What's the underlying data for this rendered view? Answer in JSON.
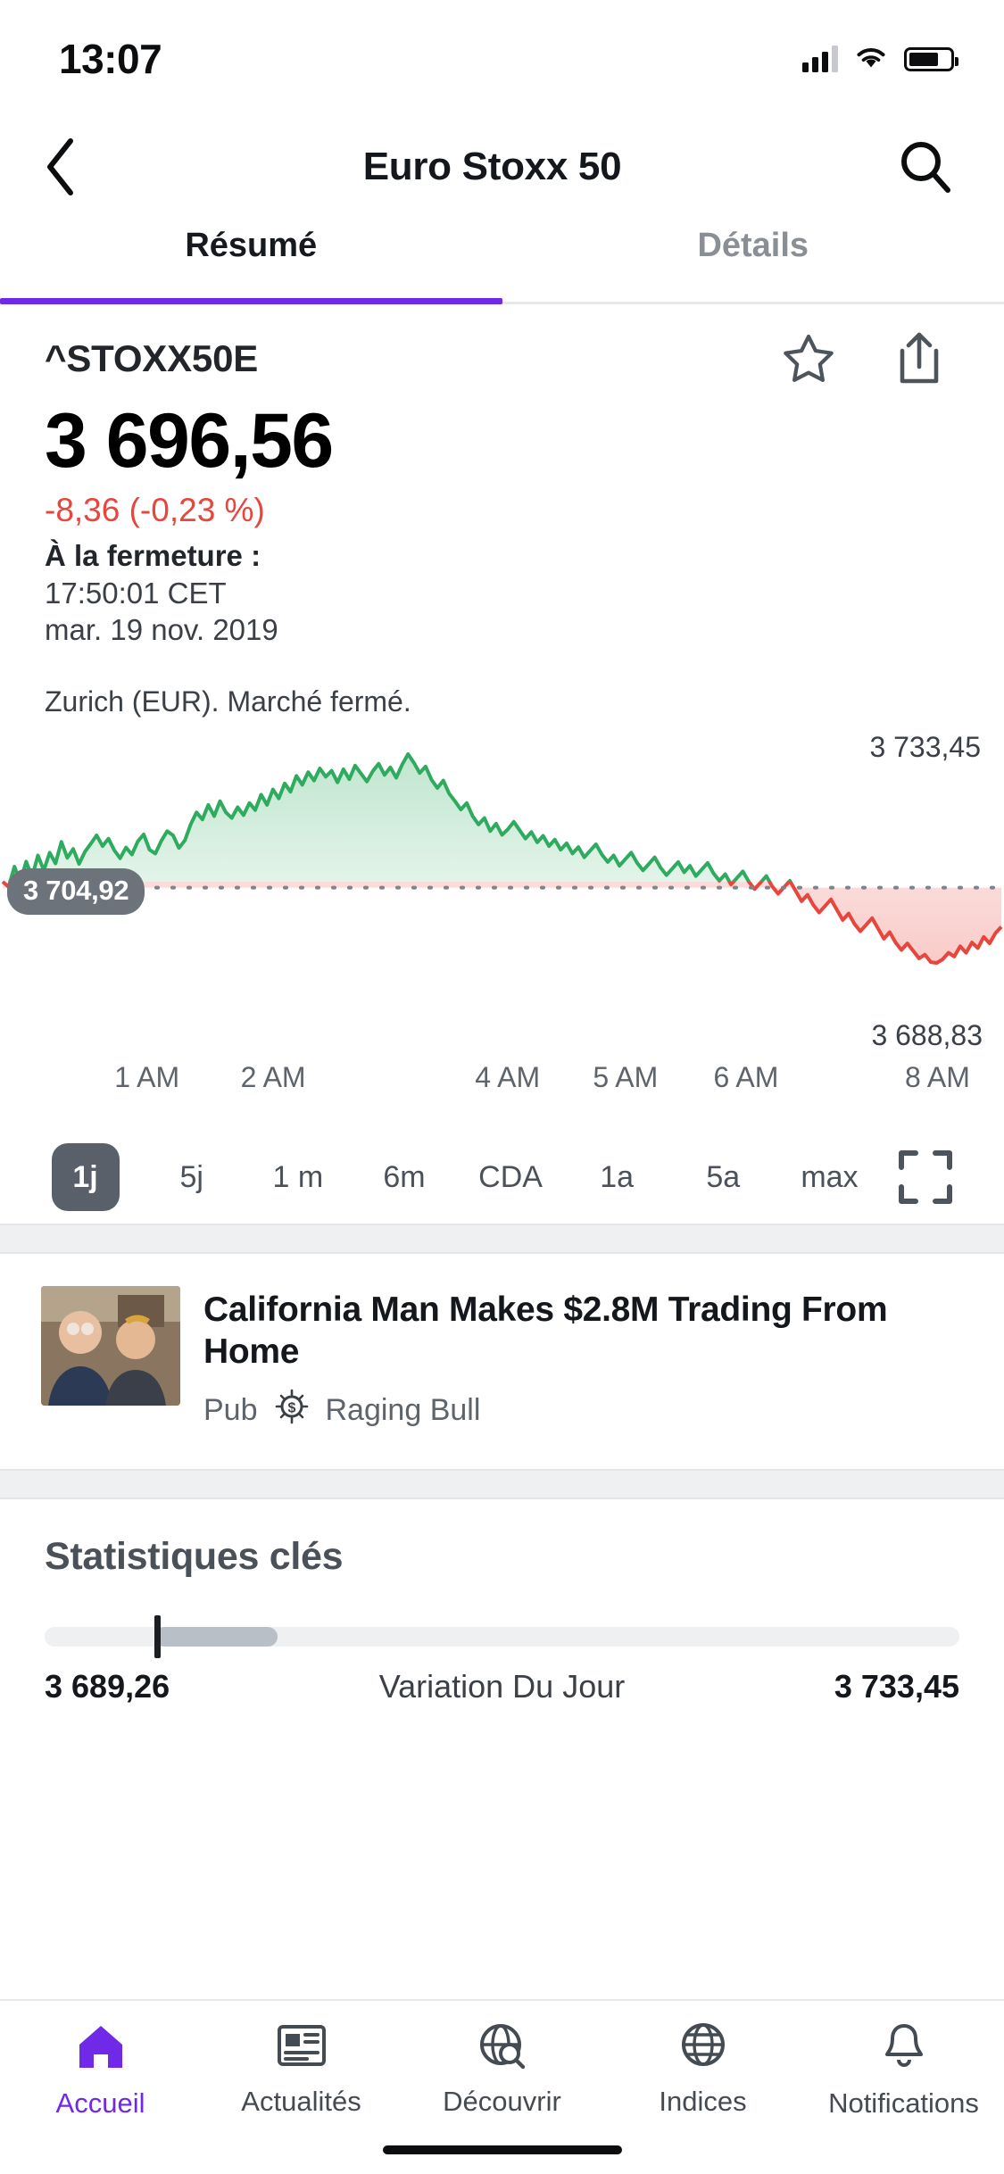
{
  "status_bar": {
    "time": "13:07",
    "signal_icon": "cellular-bars-icon",
    "wifi_icon": "wifi-icon",
    "battery_icon": "battery-icon"
  },
  "header": {
    "back_icon": "chevron-left-icon",
    "title": "Euro Stoxx 50",
    "search_icon": "search-icon"
  },
  "tabs": [
    {
      "label": "Résumé",
      "active": true
    },
    {
      "label": "Détails",
      "active": false
    }
  ],
  "quote": {
    "symbol": "^STOXX50E",
    "favorite_icon": "star-icon",
    "share_icon": "share-icon",
    "price": "3 696,56",
    "change": "-8,36 (-0,23 %)",
    "change_color": "#e8453c",
    "close_label": "À la fermeture :",
    "close_time": "17:50:01 CET",
    "close_date": "mar. 19 nov. 2019",
    "market_status": "Zurich (EUR). Marché fermé."
  },
  "chart_data": {
    "type": "area",
    "title": "",
    "xlabel": "",
    "ylabel": "",
    "high_label": "3 733,45",
    "low_label": "3 688,83",
    "previous_close_label": "3 704,92",
    "previous_close": 3704.92,
    "ylim": [
      3688.83,
      3733.45
    ],
    "grid": false,
    "legend": "none",
    "positive_color": "#2eab5e",
    "negative_color": "#e8453c",
    "xticks": [
      "1 AM",
      "2 AM",
      "4 AM",
      "5 AM",
      "6 AM",
      "8 AM"
    ],
    "xtick_positions": [
      106,
      197,
      366,
      451,
      538,
      676
    ],
    "series": [
      {
        "name": "^STOXX50E",
        "values": [
          3706.2,
          3705.1,
          3709.4,
          3706.0,
          3710.5,
          3707.2,
          3711.8,
          3708.6,
          3712.4,
          3710.1,
          3714.7,
          3711.3,
          3713.2,
          3710.0,
          3712.6,
          3714.3,
          3716.1,
          3713.8,
          3715.4,
          3712.9,
          3711.2,
          3713.5,
          3712.0,
          3714.8,
          3716.3,
          3713.0,
          3712.2,
          3714.9,
          3717.0,
          3716.1,
          3713.4,
          3715.0,
          3718.4,
          3721.0,
          3719.5,
          3722.6,
          3720.2,
          3723.4,
          3721.0,
          3719.8,
          3722.1,
          3720.4,
          3723.0,
          3721.5,
          3724.8,
          3722.6,
          3725.9,
          3724.0,
          3727.2,
          3725.4,
          3728.8,
          3726.9,
          3729.6,
          3727.8,
          3730.4,
          3728.6,
          3729.9,
          3727.4,
          3730.2,
          3728.1,
          3731.0,
          3729.3,
          3727.6,
          3729.8,
          3731.4,
          3729.0,
          3730.6,
          3728.4,
          3731.2,
          3733.45,
          3731.6,
          3729.4,
          3730.8,
          3728.0,
          3726.2,
          3727.8,
          3725.0,
          3723.4,
          3721.6,
          3723.0,
          3720.2,
          3718.4,
          3719.8,
          3717.0,
          3718.6,
          3716.2,
          3717.4,
          3719.0,
          3717.2,
          3715.4,
          3716.8,
          3714.6,
          3716.0,
          3713.8,
          3715.2,
          3713.0,
          3714.4,
          3712.2,
          3713.6,
          3711.4,
          3712.8,
          3714.2,
          3712.0,
          3710.4,
          3711.8,
          3709.6,
          3711.0,
          3712.4,
          3710.2,
          3708.6,
          3710.0,
          3711.4,
          3709.2,
          3707.6,
          3709.0,
          3710.4,
          3708.2,
          3709.6,
          3707.4,
          3708.8,
          3710.2,
          3708.0,
          3706.4,
          3707.8,
          3705.6,
          3707.0,
          3708.4,
          3706.2,
          3704.6,
          3706.0,
          3707.4,
          3705.2,
          3703.6,
          3705.0,
          3706.4,
          3704.2,
          3702.0,
          3703.4,
          3701.2,
          3699.6,
          3701.0,
          3702.4,
          3700.2,
          3698.0,
          3699.4,
          3697.2,
          3695.6,
          3697.0,
          3698.4,
          3696.2,
          3694.0,
          3695.4,
          3693.2,
          3691.6,
          3693.0,
          3691.4,
          3689.8,
          3690.6,
          3689.0,
          3688.83,
          3689.6,
          3691.0,
          3690.2,
          3692.4,
          3691.0,
          3693.2,
          3692.0,
          3694.4,
          3693.0,
          3695.2,
          3696.56
        ]
      }
    ]
  },
  "ranges": {
    "items": [
      {
        "label": "1j",
        "active": true
      },
      {
        "label": "5j",
        "active": false
      },
      {
        "label": "1 m",
        "active": false
      },
      {
        "label": "6m",
        "active": false
      },
      {
        "label": "CDA",
        "active": false
      },
      {
        "label": "1a",
        "active": false
      },
      {
        "label": "5a",
        "active": false
      },
      {
        "label": "max",
        "active": false
      }
    ],
    "fullscreen_icon": "fullscreen-icon"
  },
  "news": {
    "thumbnail": "news-thumbnail",
    "title": "California Man Makes $2.8M Trading From Home",
    "ad_label": "Pub",
    "ad_badge_icon": "dollar-badge-icon",
    "source": "Raging Bull"
  },
  "key_stats": {
    "title": "Statistiques clés",
    "day_range_low": "3 689,26",
    "day_range_label": "Variation Du Jour",
    "day_range_high": "3 733,45"
  },
  "bottom_nav": [
    {
      "label": "Accueil",
      "icon": "home-icon",
      "active": true
    },
    {
      "label": "Actualités",
      "icon": "news-icon",
      "active": false
    },
    {
      "label": "Découvrir",
      "icon": "globe-search-icon",
      "active": false
    },
    {
      "label": "Indices",
      "icon": "globe-icon",
      "active": false
    },
    {
      "label": "Notifications",
      "icon": "bell-icon",
      "active": false
    }
  ],
  "accent_color": "#7129e8",
  "home_indicator": "home-indicator"
}
